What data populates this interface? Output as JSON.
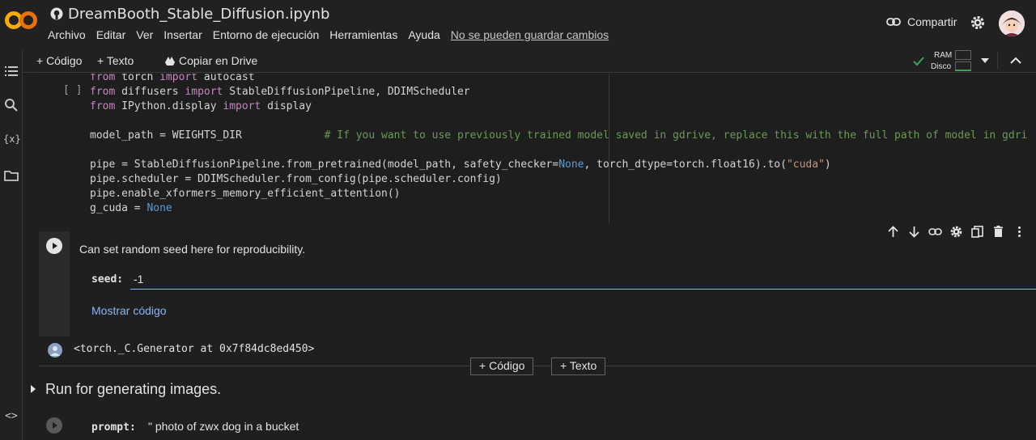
{
  "header": {
    "title": "DreamBooth_Stable_Diffusion.ipynb",
    "menu": [
      "Archivo",
      "Editar",
      "Ver",
      "Insertar",
      "Entorno de ejecución",
      "Herramientas",
      "Ayuda"
    ],
    "unsaved_notice": "No se pueden guardar cambios",
    "share_label": "Compartir"
  },
  "toolbar": {
    "add_code": "+ Código",
    "add_text": "+ Texto",
    "copy_drive": "Copiar en Drive",
    "ram_label": "RAM",
    "disk_label": "Disco"
  },
  "code_cell": {
    "run_marker": "[ ]",
    "lines": [
      {
        "parts": [
          [
            "kw",
            "from"
          ],
          [
            "",
            "torch "
          ],
          [
            "kw",
            "import"
          ],
          [
            "",
            "autocast"
          ]
        ]
      },
      {
        "parts": [
          [
            "kw",
            "from"
          ],
          [
            "",
            "diffusers "
          ],
          [
            "kw",
            "import"
          ],
          [
            "",
            "StableDiffusionPipeline, DDIMScheduler"
          ]
        ]
      },
      {
        "parts": [
          [
            "kw",
            "from"
          ],
          [
            "",
            "IPython.display "
          ],
          [
            "kw",
            "import"
          ],
          [
            "",
            "display"
          ]
        ]
      },
      {
        "parts": []
      },
      {
        "parts": [
          [
            "",
            "model_path = WEIGHTS_DIR             "
          ],
          [
            "cm",
            "# If you want to use previously trained model saved in gdrive, replace this with the full path of model in gdri"
          ]
        ]
      },
      {
        "parts": []
      },
      {
        "parts": [
          [
            "",
            "pipe = StableDiffusionPipeline.from_pretrained(model_path, safety_checker="
          ],
          [
            "bl",
            "None"
          ],
          [
            "",
            ", torch_dtype=torch.float16).to("
          ],
          [
            "st",
            "\"cuda\""
          ],
          [
            "",
            ")"
          ]
        ]
      },
      {
        "parts": [
          [
            "",
            "pipe.scheduler = DDIMScheduler.from_config(pipe.scheduler.config)"
          ]
        ]
      },
      {
        "parts": [
          [
            "",
            "pipe.enable_xformers_memory_efficient_attention()"
          ]
        ]
      },
      {
        "parts": [
          [
            "",
            "g_cuda = "
          ],
          [
            "bl",
            "None"
          ]
        ]
      }
    ]
  },
  "form_cell": {
    "description": "Can set random seed here for reproducibility.",
    "seed_label": "seed:",
    "seed_value": "-1",
    "show_code": "Mostrar código",
    "output": "<torch._C.Generator at 0x7f84dc8ed450>"
  },
  "add_buttons": {
    "code": "Código",
    "text": "Texto"
  },
  "section": {
    "title": "Run for generating images."
  },
  "prompt_cell": {
    "label": "prompt:",
    "value": "\" photo of zwx dog in a bucket"
  },
  "colors": {
    "accent_blue": "#8ab4f8",
    "orange_logo": "#f9ab00"
  }
}
